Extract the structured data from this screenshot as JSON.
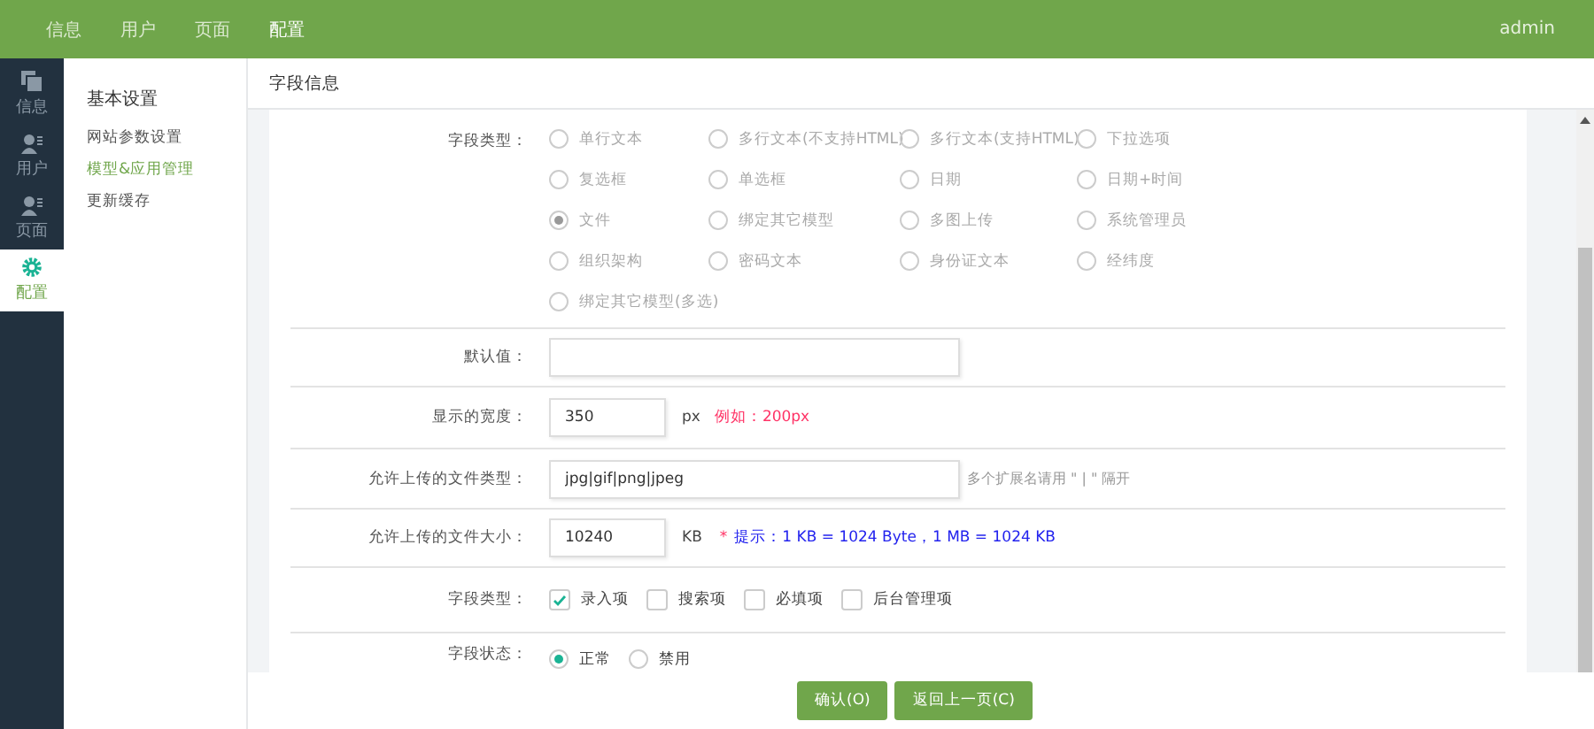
{
  "top_nav": {
    "items": [
      {
        "label": "信息",
        "selected": false
      },
      {
        "label": "用户",
        "selected": false
      },
      {
        "label": "页面",
        "selected": false
      },
      {
        "label": "配置",
        "selected": true
      }
    ],
    "user": "admin"
  },
  "sidebar": {
    "items": [
      {
        "label": "信息",
        "kind": "pages",
        "selected": false
      },
      {
        "label": "用户",
        "kind": "users",
        "selected": false
      },
      {
        "label": "页面",
        "kind": "users",
        "selected": false
      },
      {
        "label": "配置",
        "kind": "gear",
        "selected": true
      }
    ]
  },
  "submenu": {
    "heading": "基本设置",
    "items": [
      {
        "label": "网站参数设置",
        "selected": false
      },
      {
        "label": "模型&应用管理",
        "selected": true
      },
      {
        "label": "更新缓存",
        "selected": false
      }
    ]
  },
  "panel_title": "字段信息",
  "field_type": {
    "label": "字段类型：",
    "options": [
      {
        "label": "单行文本",
        "selected": false
      },
      {
        "label": "多行文本(不支持HTML)",
        "selected": false
      },
      {
        "label": "多行文本(支持HTML)",
        "selected": false
      },
      {
        "label": "下拉选项",
        "selected": false
      },
      {
        "label": "复选框",
        "selected": false
      },
      {
        "label": "单选框",
        "selected": false
      },
      {
        "label": "日期",
        "selected": false
      },
      {
        "label": "日期+时间",
        "selected": false
      },
      {
        "label": "文件",
        "selected": true
      },
      {
        "label": "绑定其它模型",
        "selected": false
      },
      {
        "label": "多图上传",
        "selected": false
      },
      {
        "label": "系统管理员",
        "selected": false
      },
      {
        "label": "组织架构",
        "selected": false
      },
      {
        "label": "密码文本",
        "selected": false
      },
      {
        "label": "身份证文本",
        "selected": false
      },
      {
        "label": "经纬度",
        "selected": false
      },
      {
        "label": "绑定其它模型(多选)",
        "selected": false
      }
    ]
  },
  "default_value": {
    "label": "默认值："
  },
  "display_width": {
    "label": "显示的宽度：",
    "value": "350",
    "unit": "px",
    "hint": "例如：200px"
  },
  "allowed_types": {
    "label": "允许上传的文件类型：",
    "value": "jpg|gif|png|jpeg",
    "hint": "多个扩展名请用 \" | \" 隔开"
  },
  "allowed_size": {
    "label": "允许上传的文件大小：",
    "value": "10240",
    "unit": "KB",
    "hint_mark": "*",
    "hint": "提示：1 KB = 1024 Byte，1 MB = 1024 KB"
  },
  "field_flags": {
    "label": "字段类型：",
    "options": [
      {
        "label": "录入项",
        "checked": true
      },
      {
        "label": "搜索项",
        "checked": false
      },
      {
        "label": "必填项",
        "checked": false
      },
      {
        "label": "后台管理项",
        "checked": false
      }
    ]
  },
  "field_status": {
    "label": "字段状态：",
    "options": [
      {
        "label": "正常",
        "selected": true
      },
      {
        "label": "禁用",
        "selected": false
      }
    ]
  },
  "buttons": [
    {
      "label": "确认(O)"
    },
    {
      "label": "返回上一页(C)"
    }
  ]
}
